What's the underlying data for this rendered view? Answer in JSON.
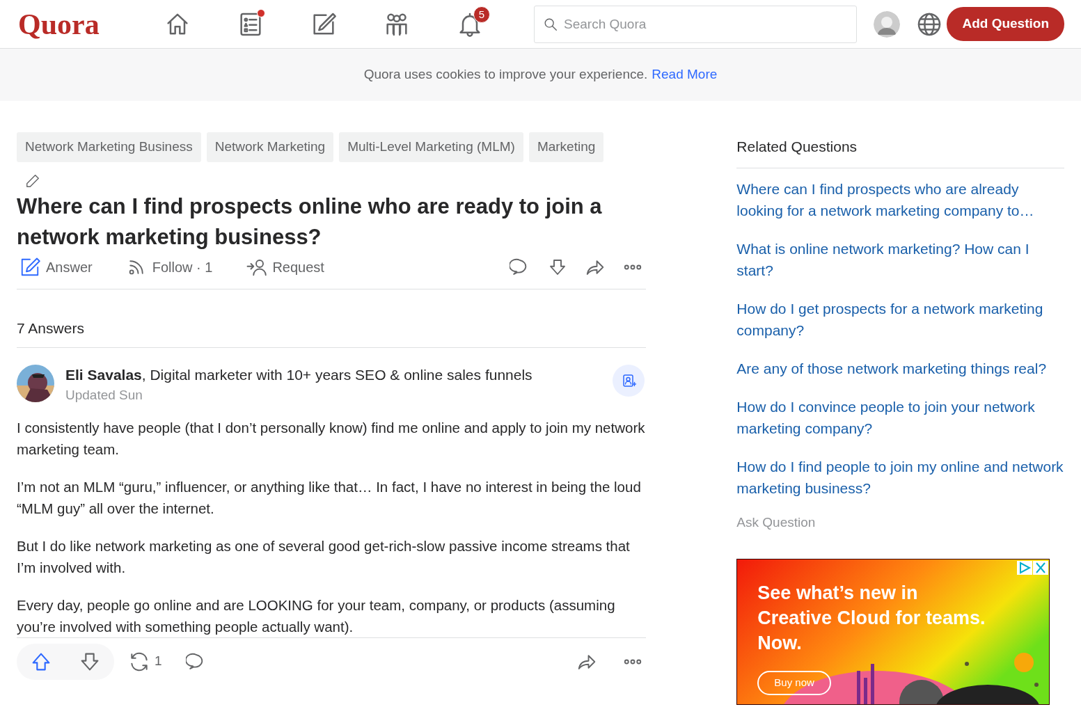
{
  "header": {
    "logo": "Quora",
    "nav": [
      {
        "kind": "home",
        "unread": false
      },
      {
        "kind": "answer",
        "unread": true
      },
      {
        "kind": "write",
        "unread": false
      },
      {
        "kind": "spaces",
        "unread": false
      },
      {
        "kind": "bell",
        "badge": "5"
      }
    ],
    "search": {
      "placeholder": "Search Quora"
    },
    "add_button": "Add Question"
  },
  "cookie_bar": {
    "text": "Quora uses cookies to improve your experience.",
    "link": "Read More"
  },
  "topics": [
    "Network Marketing Business",
    "Network Marketing",
    "Multi-Level Marketing (MLM)",
    "Marketing"
  ],
  "question": {
    "title": "Where can I find prospects online who are ready to join a network marketing business?",
    "actions": [
      {
        "kind": "answer",
        "label": "Answer"
      },
      {
        "kind": "follow",
        "label": "Follow",
        "count": "· 1"
      },
      {
        "kind": "request",
        "label": "Request"
      }
    ]
  },
  "answers_count": "7 Answers",
  "answer": {
    "author": "Eli Savalas",
    "credential": ", Digital marketer with 10+ years SEO & online sales funnels",
    "updated": "Updated Sun",
    "paragraphs": [
      "I consistently have people (that I don’t personally know) find me online and apply to join my network marketing team.",
      "I’m not an MLM “guru,” influencer, or anything like that… In fact, I have no interest in being the loud “MLM guy” all over the internet.",
      "But I do like network marketing as one of several good get-rich-slow passive income streams that I’m involved with.",
      "Every day, people go online and are LOOKING for your team, company, or products (assuming you’re involved with something people actually want)."
    ],
    "upvoted": true,
    "share_count": "1"
  },
  "related": {
    "title": "Related Questions",
    "questions": [
      "Where can I find prospects who are already looking for a network marketing company to…",
      "What is online network marketing? How can I start?",
      "How do I get prospects for a network marketing company?",
      "Are any of those network marketing things real?",
      "How do I convince people to join your network marketing company?",
      "How do I find people to join my online and network marketing business?"
    ],
    "ask": "Ask Question"
  },
  "ad": {
    "lines": [
      "See what’s new in",
      "Creative Cloud for teams.",
      "Now."
    ],
    "button": "Buy now"
  }
}
